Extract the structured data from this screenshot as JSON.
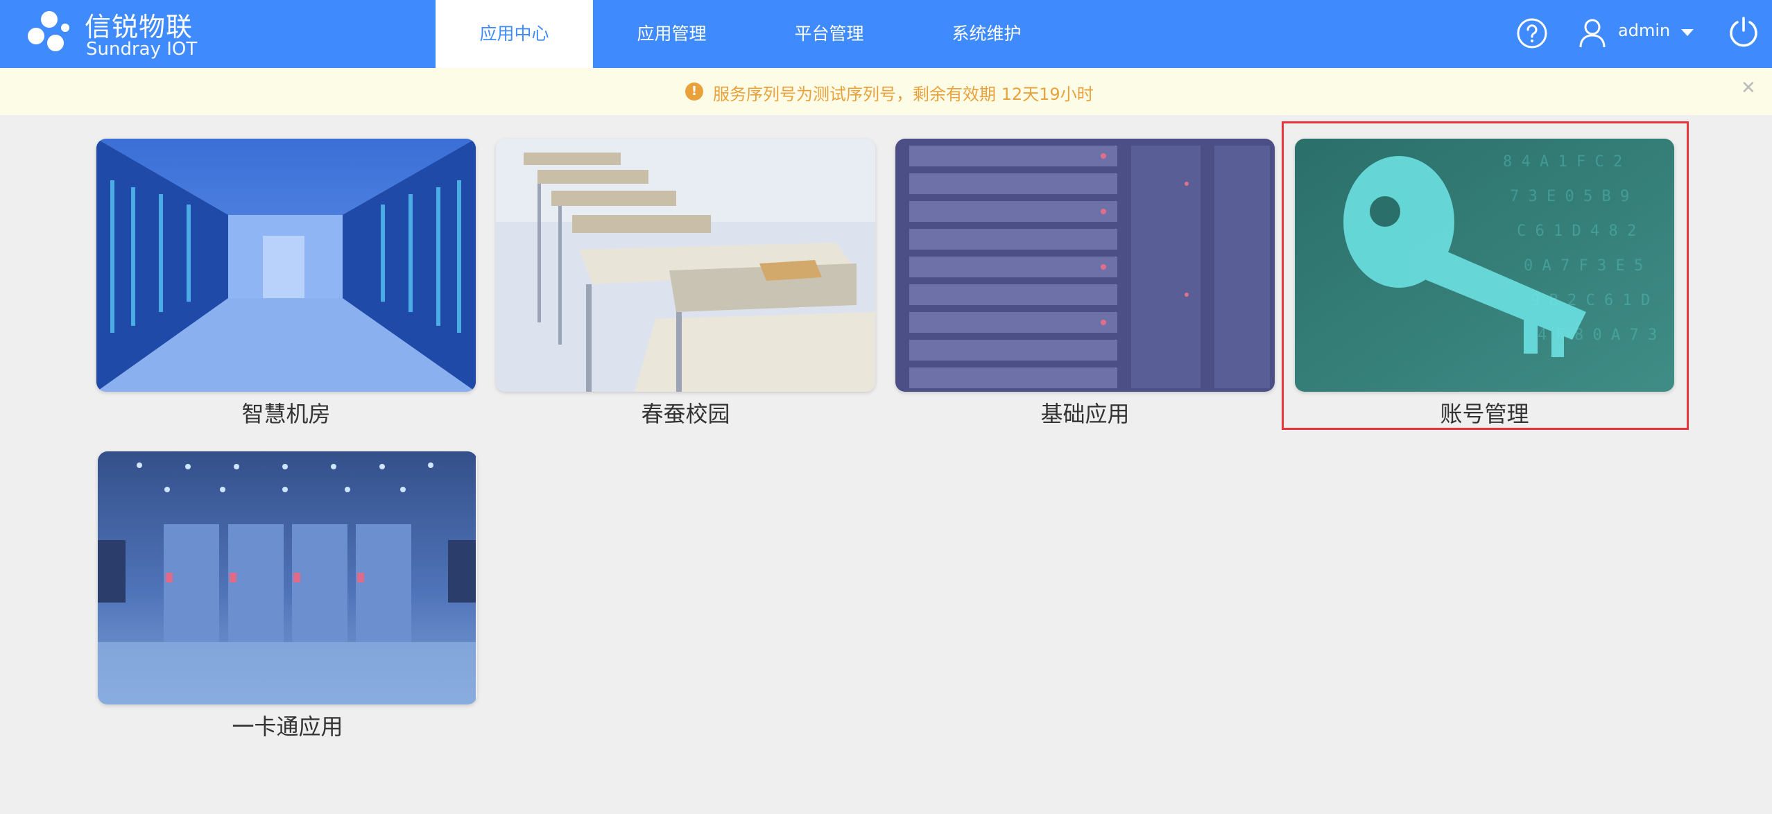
{
  "header": {
    "logo_cn": "信锐物联",
    "logo_en": "Sundray IOT",
    "tabs": [
      {
        "label": "应用中心",
        "active": true
      },
      {
        "label": "应用管理",
        "active": false
      },
      {
        "label": "平台管理",
        "active": false
      },
      {
        "label": "系统维护",
        "active": false
      }
    ],
    "help_icon": "help-circle-icon",
    "user_icon": "user-icon",
    "username": "admin",
    "power_icon": "power-icon",
    "bg_color": "#3f8bfd"
  },
  "notice": {
    "icon": "warning-icon",
    "text": "服务序列号为测试序列号，剩余有效期 12天19小时",
    "close_icon": "close-icon",
    "color": "#e9a23b"
  },
  "apps": [
    {
      "label": "智慧机房",
      "image": "server-room-corridor"
    },
    {
      "label": "春蚕校园",
      "image": "classroom-desks"
    },
    {
      "label": "基础应用",
      "image": "server-rack"
    },
    {
      "label": "账号管理",
      "image": "digital-key",
      "selected": true
    },
    {
      "label": "一卡通应用",
      "image": "data-center-hall"
    }
  ]
}
